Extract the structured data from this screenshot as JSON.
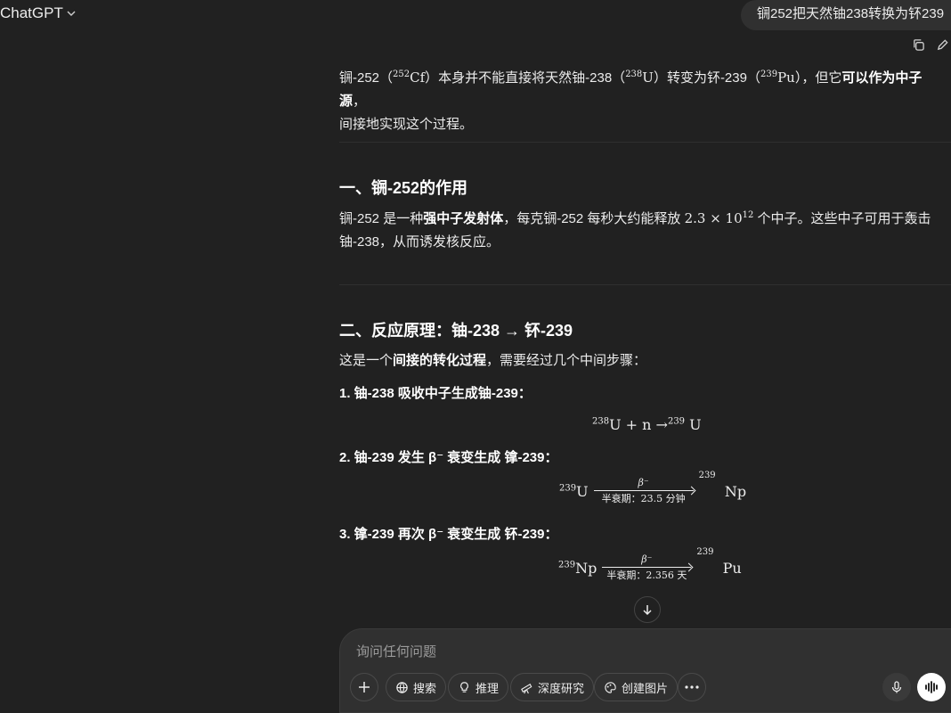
{
  "header": {
    "app_title": "ChatGPT",
    "user_message": "锎252把天然铀238转换为钚239"
  },
  "answer": {
    "intro_a": "锎-252（",
    "intro_cf_mass": "252",
    "intro_cf": "Cf",
    "intro_b": "）本身并不能直接将天然铀-238（",
    "intro_u_mass": "238",
    "intro_u": "U",
    "intro_c": "）转变为钚-239（",
    "intro_pu_mass": "239",
    "intro_pu": "Pu",
    "intro_d": "），但它",
    "intro_bold": "可以作为中子源",
    "intro_e": "，",
    "intro_line2": "间接地实现这个过程。",
    "section1_title": "一、锎-252的作用",
    "s1_a": "锎-252 是一种",
    "s1_bold": "强中子发射体",
    "s1_b": "，每克锎-252 每秒大约能释放 ",
    "s1_num": "2.3 × 10",
    "s1_exp": "12",
    "s1_c": " 个中子。这些中子可用于轰击",
    "s1_line2": "铀-238，从而诱发核反应。",
    "section2_title": "二、反应原理：铀-238 → 钚-239",
    "s2_a": "这是一个",
    "s2_bold": "间接的转化过程",
    "s2_b": "，需要经过几个中间步骤：",
    "step1": "1. 铀-238 吸收中子生成铀-239：",
    "eq1_m1": "238",
    "eq1_body": "U + n →",
    "eq1_m2": "239",
    "eq1_end": " U",
    "step2": "2. 铀-239 发生 β⁻ 衰变生成 镎-239：",
    "eq2_m1": "239",
    "eq2_left": "U",
    "eq2_above": "β⁻",
    "eq2_below": "半衰期：23.5 分钟",
    "eq2_m2": "239",
    "eq2_right": "Np",
    "step3": "3. 镎-239 再次 β⁻ 衰变生成 钚-239：",
    "eq3_m1": "239",
    "eq3_left": "Np",
    "eq3_above": "β⁻",
    "eq3_below": "半衰期：2.356 天",
    "eq3_m2": "239",
    "eq3_right": "Pu"
  },
  "composer": {
    "placeholder": "询问任何问题",
    "search": "搜索",
    "reason": "推理",
    "deep_research": "深度研究",
    "create_image": "创建图片"
  }
}
